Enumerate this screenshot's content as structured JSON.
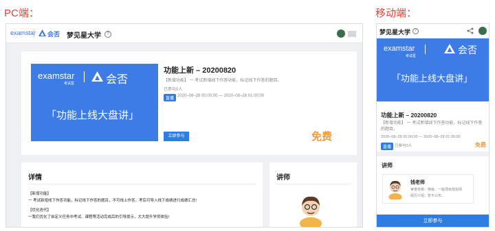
{
  "labels": {
    "pc": "PC端：",
    "mobile": "移动端："
  },
  "header": {
    "logo_text": "examstar",
    "hq_text": "会否",
    "university": "梦见星大学",
    "info_icon": "?"
  },
  "course": {
    "banner_brand": "examstar",
    "banner_brand_sub": "考试星",
    "banner_hq": "会否",
    "banner_title": "「功能上线大盘讲」",
    "title": "功能上新 – 20200820",
    "desc_pc": "【新增功能】 一 考试新增线下作答功能，标记线下作答的题目。",
    "desc_mob": "【新增功能】 一 考试新增线下作答功能，标记线下作答的题目。",
    "participants": "已参与0人",
    "status_badge": "直播",
    "time_range": "2020–08–28 00:00:00 — 2020–08–28 01:00:00",
    "join_label": "立即参与",
    "price": "免费"
  },
  "detail": {
    "heading": "详情",
    "line1": "【新增功能】",
    "line2": "一 考试新增线下作答功能，标记线下作答的题目，不可线上作答，考后可导入线下成绩进行成绩汇总!",
    "line3": "【优化迭代】",
    "line4": "一我们优化了自定义任务中考试、课程等活动完成后的引导提示，大大提升学员体验!"
  },
  "teacher": {
    "heading": "讲师",
    "name": "钱老师",
    "bio_line1": "荣誉奖章：特级、一级项目规划师",
    "bio_line2": "经历介绍：暂不公布..."
  },
  "colors": {
    "primary": "#2f7de1",
    "banner": "#3d7ce6",
    "accent_red": "#e8413a",
    "price_orange": "#f39a3a"
  }
}
